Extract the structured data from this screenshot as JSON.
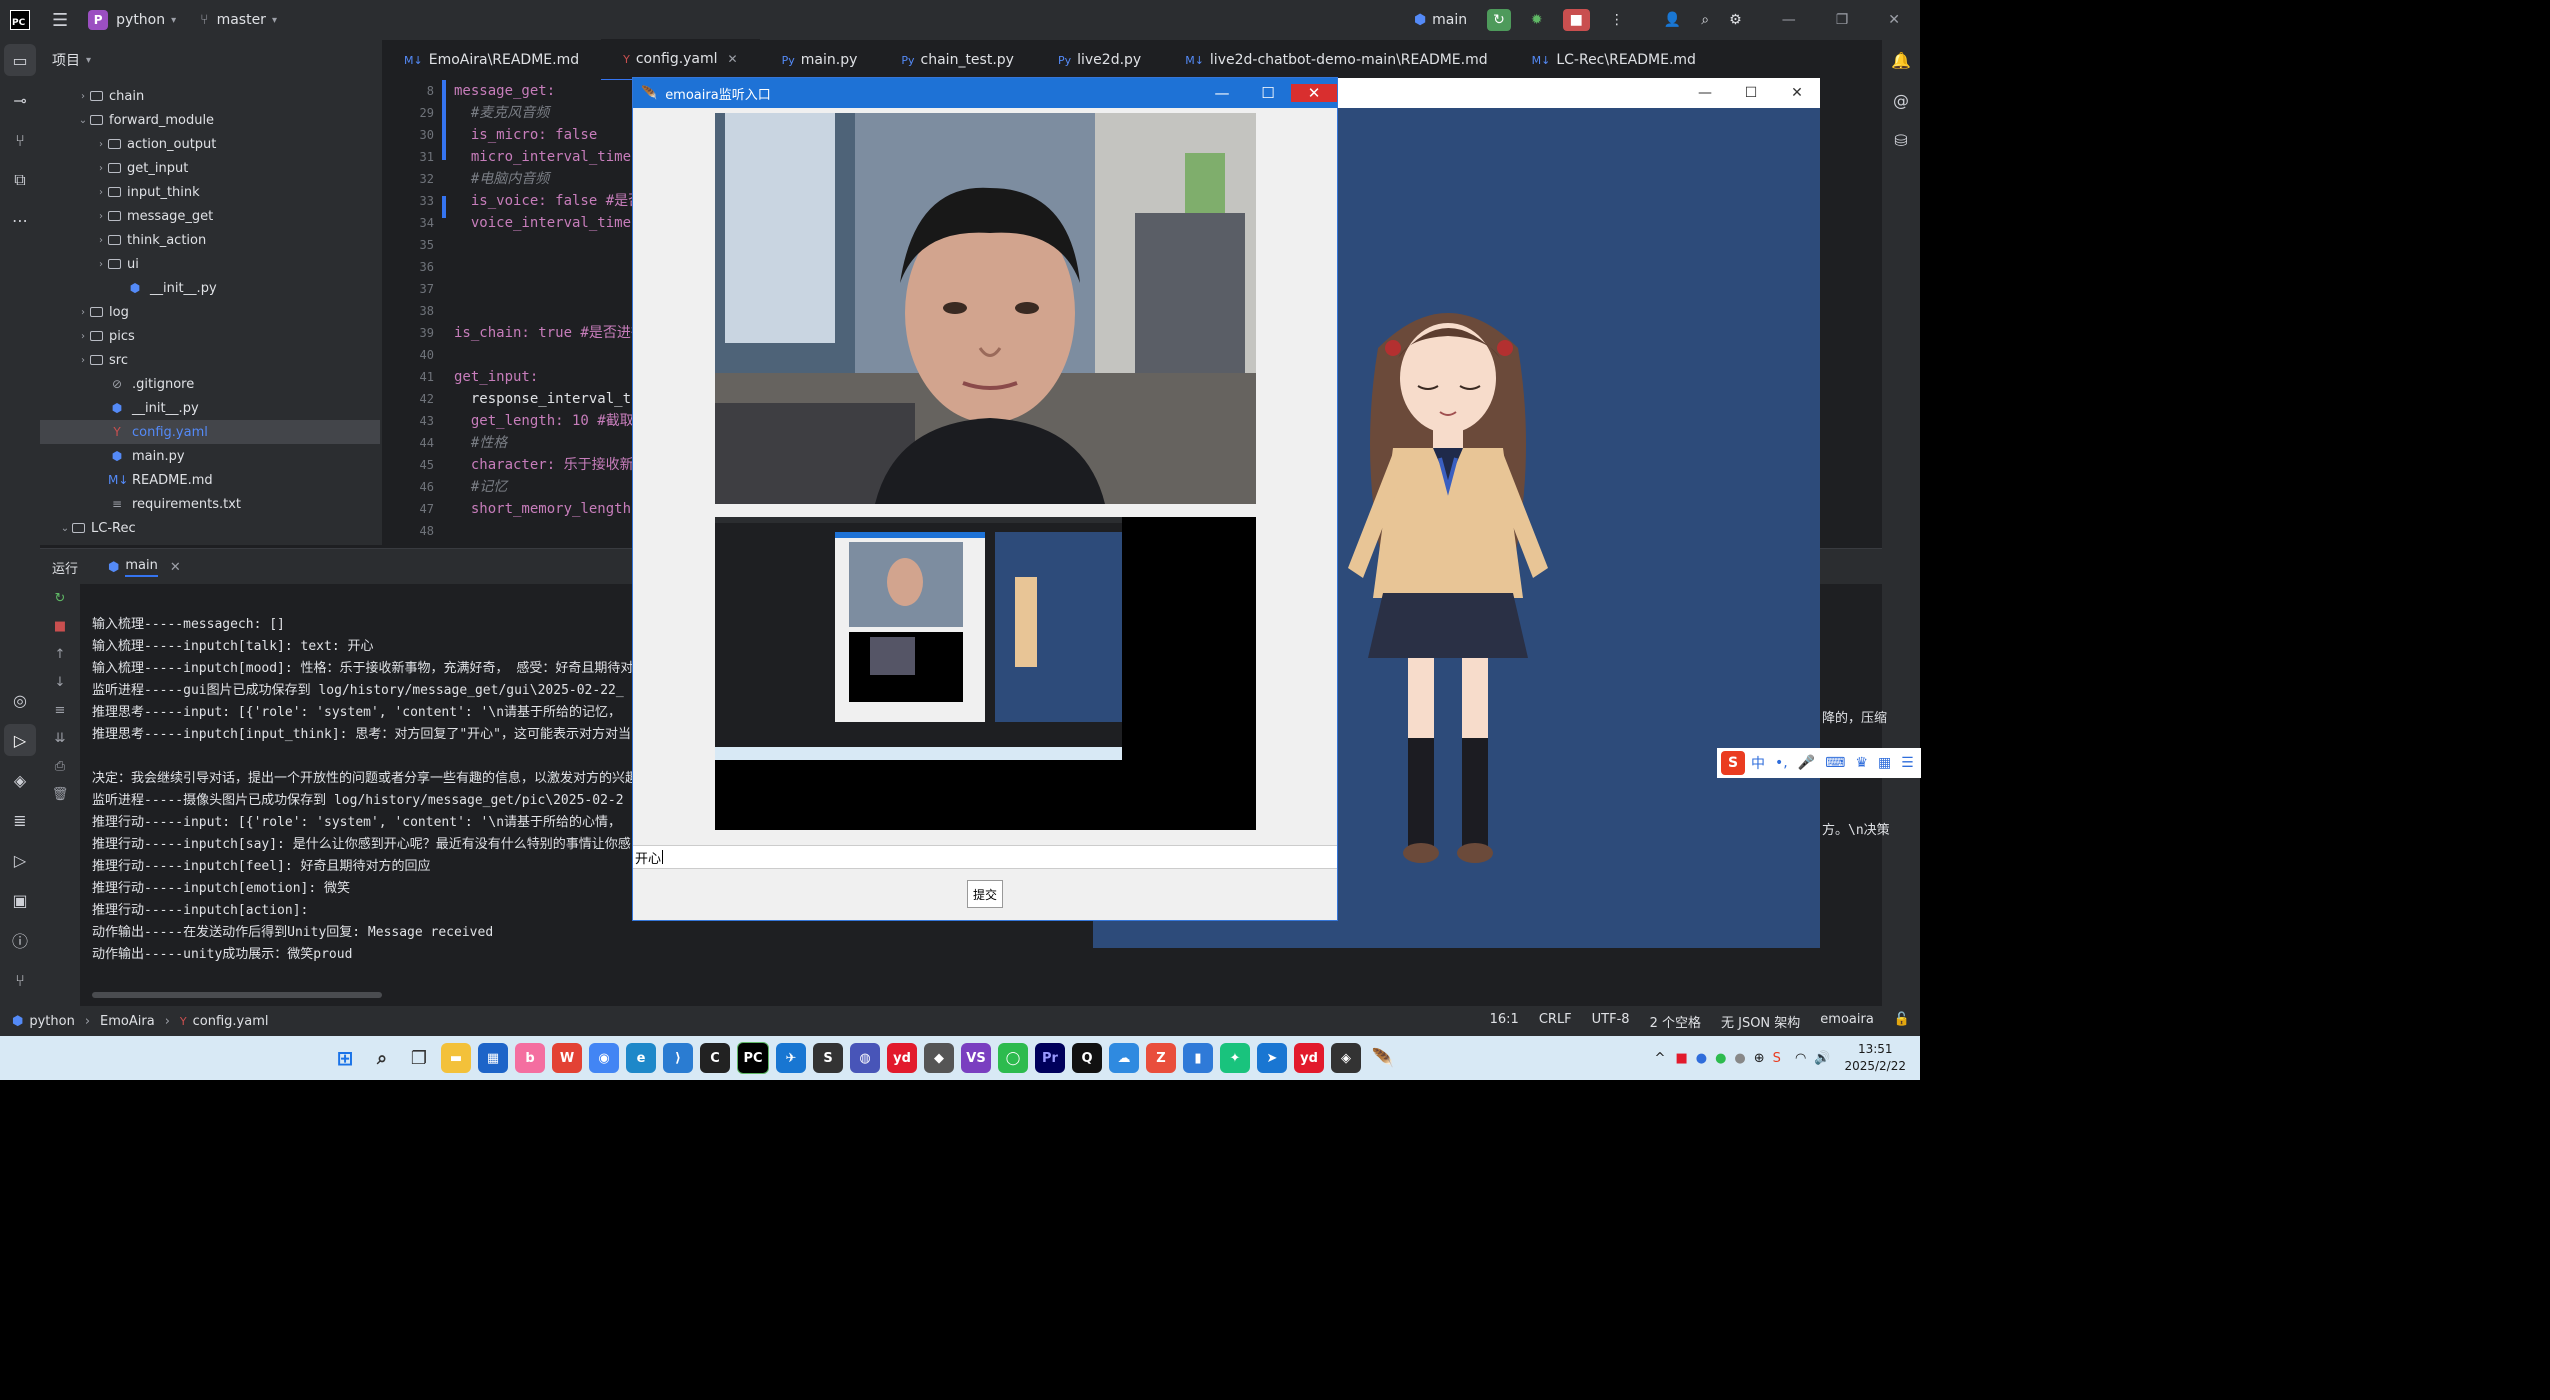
{
  "topbar": {
    "project_initial": "P",
    "project_name": "python",
    "branch": "master",
    "run_config": "main"
  },
  "project_panel": {
    "title": "项目",
    "items": [
      {
        "label": "chain",
        "type": "folder",
        "depth": 2,
        "chevron": "›"
      },
      {
        "label": "forward_module",
        "type": "folder",
        "depth": 2,
        "chevron": "⌄"
      },
      {
        "label": "action_output",
        "type": "folder",
        "depth": 3,
        "chevron": "›"
      },
      {
        "label": "get_input",
        "type": "folder",
        "depth": 3,
        "chevron": "›"
      },
      {
        "label": "input_think",
        "type": "folder",
        "depth": 3,
        "chevron": "›"
      },
      {
        "label": "message_get",
        "type": "folder",
        "depth": 3,
        "chevron": "›"
      },
      {
        "label": "think_action",
        "type": "folder",
        "depth": 3,
        "chevron": "›"
      },
      {
        "label": "ui",
        "type": "folder",
        "depth": 3,
        "chevron": "›"
      },
      {
        "label": "__init__.py",
        "type": "python",
        "depth": 4,
        "chevron": ""
      },
      {
        "label": "log",
        "type": "folder",
        "depth": 2,
        "chevron": "›"
      },
      {
        "label": "pics",
        "type": "folder",
        "depth": 2,
        "chevron": "›"
      },
      {
        "label": "src",
        "type": "folder",
        "depth": 2,
        "chevron": "›"
      },
      {
        "label": ".gitignore",
        "type": "ignore",
        "depth": 3,
        "chevron": ""
      },
      {
        "label": "__init__.py",
        "type": "python",
        "depth": 3,
        "chevron": ""
      },
      {
        "label": "config.yaml",
        "type": "yaml",
        "depth": 3,
        "chevron": "",
        "selected": true
      },
      {
        "label": "main.py",
        "type": "python",
        "depth": 3,
        "chevron": ""
      },
      {
        "label": "README.md",
        "type": "md",
        "depth": 3,
        "chevron": ""
      },
      {
        "label": "requirements.txt",
        "type": "text",
        "depth": 3,
        "chevron": ""
      },
      {
        "label": "LC-Rec",
        "type": "folder",
        "depth": 1,
        "chevron": "⌄"
      }
    ]
  },
  "tabs": [
    {
      "icon": "M↓",
      "label": "EmoAira\\README.md"
    },
    {
      "icon": "Y",
      "label": "config.yaml",
      "active": true
    },
    {
      "icon": "Py",
      "label": "main.py"
    },
    {
      "icon": "Py",
      "label": "chain_test.py"
    },
    {
      "icon": "Py",
      "label": "live2d.py"
    },
    {
      "icon": "M↓",
      "label": "live2d-chatbot-demo-main\\README.md"
    },
    {
      "icon": "M↓",
      "label": "LC-Rec\\README.md"
    }
  ],
  "editor": {
    "line_numbers": [
      "8",
      "29",
      "30",
      "31",
      "32",
      "33",
      "34",
      "35",
      "36",
      "37",
      "38",
      "39",
      "40",
      "41",
      "42",
      "43",
      "44",
      "45",
      "46",
      "47",
      "48"
    ],
    "lines": [
      "message_get:",
      "  #麦克风音频",
      "  is_micro: false",
      "  micro_interval_time:",
      "  #电脑内音频",
      "  is_voice: false #是否",
      "  voice_interval_time:",
      "",
      "",
      "",
      "",
      "is_chain: true #是否进行",
      "",
      "get_input:",
      "  response_interval_tim",
      "  get_length: 10 #截取",
      "  #性格",
      "  character: 乐于接收新事",
      "  #记忆",
      "  short_memory_length:",
      ""
    ]
  },
  "run_panel": {
    "title": "运行",
    "tab": "main"
  },
  "console": {
    "lines": [
      "输入梳理-----messagech: []",
      "输入梳理-----inputch[talk]: text: 开心",
      "输入梳理-----inputch[mood]: 性格：乐于接收新事物，充满好奇， 感受：好奇且期待对",
      "监听进程-----gui图片已成功保存到 log/history/message_get/gui\\2025-02-22_",
      "推理思考-----input: [{'role': 'system', 'content': '\\n请基于所给的记忆，",
      "推理思考-----inputch[input_think]: 思考：对方回复了\"开心\"，这可能表示对方对当",
      "",
      "决定：我会继续引导对话，提出一个开放性的问题或者分享一些有趣的信息，以激发对方的兴趣",
      "监听进程-----摄像头图片已成功保存到 log/history/message_get/pic\\2025-02-2",
      "推理行动-----input: [{'role': 'system', 'content': '\\n请基于所给的心情，",
      "推理行动-----inputch[say]: 是什么让你感到开心呢？最近有没有什么特别的事情让你感",
      "推理行动-----inputch[feel]: 好奇且期待对方的回应",
      "推理行动-----inputch[emotion]: 微笑",
      "推理行动-----inputch[action]:",
      "动作输出-----在发送动作后得到Unity回复: Message received",
      "动作输出-----unity成功展示：微笑proud"
    ],
    "peek_right_1": "降的，压缩",
    "peek_right_2": "方。\\n决策"
  },
  "statusbar": {
    "crumbs": [
      "python",
      "EmoAira",
      "config.yaml"
    ],
    "position": "16:1",
    "line_ending": "CRLF",
    "encoding": "UTF-8",
    "indent": "2 个空格",
    "schema": "无 JSON 架构",
    "interpreter": "emoaira"
  },
  "dialog": {
    "title": "emoaira监听入口",
    "input_value": "开心",
    "submit_label": "提交"
  },
  "ime": {
    "mode": "中"
  },
  "taskbar": {
    "time": "13:51",
    "date": "2025/2/22"
  }
}
